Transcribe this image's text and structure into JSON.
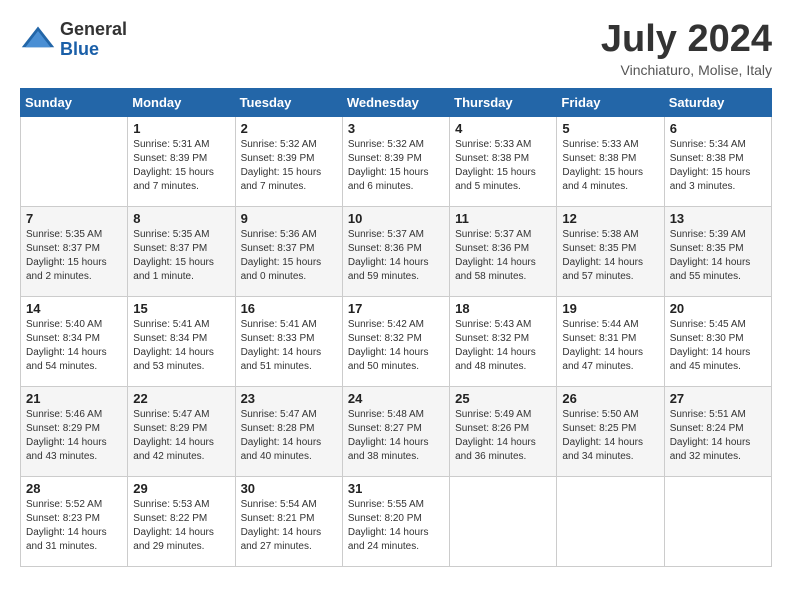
{
  "header": {
    "logo_line1": "General",
    "logo_line2": "Blue",
    "month": "July 2024",
    "location": "Vinchiaturo, Molise, Italy"
  },
  "weekdays": [
    "Sunday",
    "Monday",
    "Tuesday",
    "Wednesday",
    "Thursday",
    "Friday",
    "Saturday"
  ],
  "weeks": [
    [
      {
        "day": "",
        "info": ""
      },
      {
        "day": "1",
        "info": "Sunrise: 5:31 AM\nSunset: 8:39 PM\nDaylight: 15 hours\nand 7 minutes."
      },
      {
        "day": "2",
        "info": "Sunrise: 5:32 AM\nSunset: 8:39 PM\nDaylight: 15 hours\nand 7 minutes."
      },
      {
        "day": "3",
        "info": "Sunrise: 5:32 AM\nSunset: 8:39 PM\nDaylight: 15 hours\nand 6 minutes."
      },
      {
        "day": "4",
        "info": "Sunrise: 5:33 AM\nSunset: 8:38 PM\nDaylight: 15 hours\nand 5 minutes."
      },
      {
        "day": "5",
        "info": "Sunrise: 5:33 AM\nSunset: 8:38 PM\nDaylight: 15 hours\nand 4 minutes."
      },
      {
        "day": "6",
        "info": "Sunrise: 5:34 AM\nSunset: 8:38 PM\nDaylight: 15 hours\nand 3 minutes."
      }
    ],
    [
      {
        "day": "7",
        "info": "Sunrise: 5:35 AM\nSunset: 8:37 PM\nDaylight: 15 hours\nand 2 minutes."
      },
      {
        "day": "8",
        "info": "Sunrise: 5:35 AM\nSunset: 8:37 PM\nDaylight: 15 hours\nand 1 minute."
      },
      {
        "day": "9",
        "info": "Sunrise: 5:36 AM\nSunset: 8:37 PM\nDaylight: 15 hours\nand 0 minutes."
      },
      {
        "day": "10",
        "info": "Sunrise: 5:37 AM\nSunset: 8:36 PM\nDaylight: 14 hours\nand 59 minutes."
      },
      {
        "day": "11",
        "info": "Sunrise: 5:37 AM\nSunset: 8:36 PM\nDaylight: 14 hours\nand 58 minutes."
      },
      {
        "day": "12",
        "info": "Sunrise: 5:38 AM\nSunset: 8:35 PM\nDaylight: 14 hours\nand 57 minutes."
      },
      {
        "day": "13",
        "info": "Sunrise: 5:39 AM\nSunset: 8:35 PM\nDaylight: 14 hours\nand 55 minutes."
      }
    ],
    [
      {
        "day": "14",
        "info": "Sunrise: 5:40 AM\nSunset: 8:34 PM\nDaylight: 14 hours\nand 54 minutes."
      },
      {
        "day": "15",
        "info": "Sunrise: 5:41 AM\nSunset: 8:34 PM\nDaylight: 14 hours\nand 53 minutes."
      },
      {
        "day": "16",
        "info": "Sunrise: 5:41 AM\nSunset: 8:33 PM\nDaylight: 14 hours\nand 51 minutes."
      },
      {
        "day": "17",
        "info": "Sunrise: 5:42 AM\nSunset: 8:32 PM\nDaylight: 14 hours\nand 50 minutes."
      },
      {
        "day": "18",
        "info": "Sunrise: 5:43 AM\nSunset: 8:32 PM\nDaylight: 14 hours\nand 48 minutes."
      },
      {
        "day": "19",
        "info": "Sunrise: 5:44 AM\nSunset: 8:31 PM\nDaylight: 14 hours\nand 47 minutes."
      },
      {
        "day": "20",
        "info": "Sunrise: 5:45 AM\nSunset: 8:30 PM\nDaylight: 14 hours\nand 45 minutes."
      }
    ],
    [
      {
        "day": "21",
        "info": "Sunrise: 5:46 AM\nSunset: 8:29 PM\nDaylight: 14 hours\nand 43 minutes."
      },
      {
        "day": "22",
        "info": "Sunrise: 5:47 AM\nSunset: 8:29 PM\nDaylight: 14 hours\nand 42 minutes."
      },
      {
        "day": "23",
        "info": "Sunrise: 5:47 AM\nSunset: 8:28 PM\nDaylight: 14 hours\nand 40 minutes."
      },
      {
        "day": "24",
        "info": "Sunrise: 5:48 AM\nSunset: 8:27 PM\nDaylight: 14 hours\nand 38 minutes."
      },
      {
        "day": "25",
        "info": "Sunrise: 5:49 AM\nSunset: 8:26 PM\nDaylight: 14 hours\nand 36 minutes."
      },
      {
        "day": "26",
        "info": "Sunrise: 5:50 AM\nSunset: 8:25 PM\nDaylight: 14 hours\nand 34 minutes."
      },
      {
        "day": "27",
        "info": "Sunrise: 5:51 AM\nSunset: 8:24 PM\nDaylight: 14 hours\nand 32 minutes."
      }
    ],
    [
      {
        "day": "28",
        "info": "Sunrise: 5:52 AM\nSunset: 8:23 PM\nDaylight: 14 hours\nand 31 minutes."
      },
      {
        "day": "29",
        "info": "Sunrise: 5:53 AM\nSunset: 8:22 PM\nDaylight: 14 hours\nand 29 minutes."
      },
      {
        "day": "30",
        "info": "Sunrise: 5:54 AM\nSunset: 8:21 PM\nDaylight: 14 hours\nand 27 minutes."
      },
      {
        "day": "31",
        "info": "Sunrise: 5:55 AM\nSunset: 8:20 PM\nDaylight: 14 hours\nand 24 minutes."
      },
      {
        "day": "",
        "info": ""
      },
      {
        "day": "",
        "info": ""
      },
      {
        "day": "",
        "info": ""
      }
    ]
  ]
}
